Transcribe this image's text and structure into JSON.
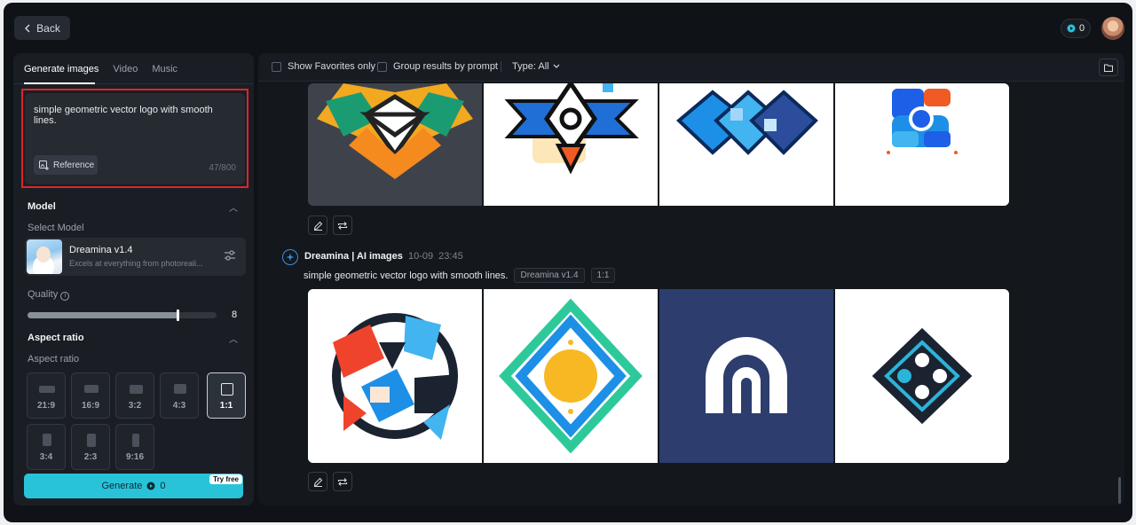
{
  "header": {
    "back_label": "Back",
    "credits": "0"
  },
  "left_panel": {
    "tabs": [
      {
        "label": "Generate images"
      },
      {
        "label": "Video"
      },
      {
        "label": "Music"
      }
    ],
    "prompt": {
      "value": "simple geometric vector logo with smooth lines.",
      "reference_label": "Reference",
      "char_count": "47/800"
    },
    "model": {
      "section_title": "Model",
      "select_label": "Select Model",
      "name": "Dreamina v1.4",
      "description": "Excels at everything from photoreali..."
    },
    "quality": {
      "label": "Quality",
      "value": "8",
      "fraction": 0.8
    },
    "aspect": {
      "section_title": "Aspect ratio",
      "sub_label": "Aspect ratio",
      "options": [
        "21:9",
        "16:9",
        "3:2",
        "4:3",
        "1:1",
        "3:4",
        "2:3",
        "9:16"
      ],
      "selected": "1:1"
    },
    "generate": {
      "label": "Generate",
      "cost": "0",
      "badge": "Try free"
    }
  },
  "toolbar": {
    "favorites_label": "Show Favorites only",
    "group_label": "Group results by prompt",
    "type_label": "Type: All"
  },
  "groups": [
    {
      "author": "Dreamina | AI images",
      "date": "10-09",
      "time": "23:45",
      "prompt": "simple geometric vector logo with smooth lines.",
      "model_tag": "Dreamina v1.4",
      "ratio_tag": "1:1"
    }
  ],
  "colors": {
    "accent": "#29c3d9",
    "highlight": "#e0242b"
  }
}
